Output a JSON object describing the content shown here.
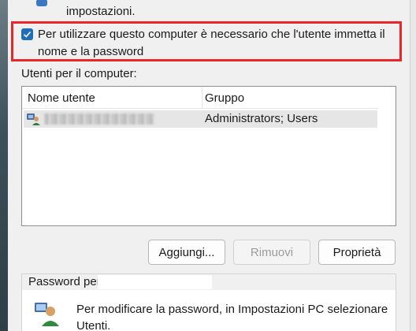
{
  "header": {
    "intro_text": "impostazioni."
  },
  "login_option": {
    "checked": true,
    "label": "Per utilizzare questo computer è necessario che l'utente immetta il nome e la password"
  },
  "users": {
    "section_label": "Utenti per il computer:",
    "columns": [
      "Nome utente",
      "Gruppo"
    ],
    "rows": [
      {
        "name_blurred": true,
        "group": "Administrators; Users"
      }
    ]
  },
  "buttons": {
    "add": "Aggiungi...",
    "remove": "Rimuovi",
    "properties": "Proprietà"
  },
  "password_group": {
    "title": "Password per",
    "text": "Per modificare la password, in Impostazioni PC selezionare Utenti."
  },
  "colors": {
    "highlight_border": "#e8262b",
    "checkbox_fill": "#1f6fb8",
    "selected_row": "#e6e6e6"
  }
}
